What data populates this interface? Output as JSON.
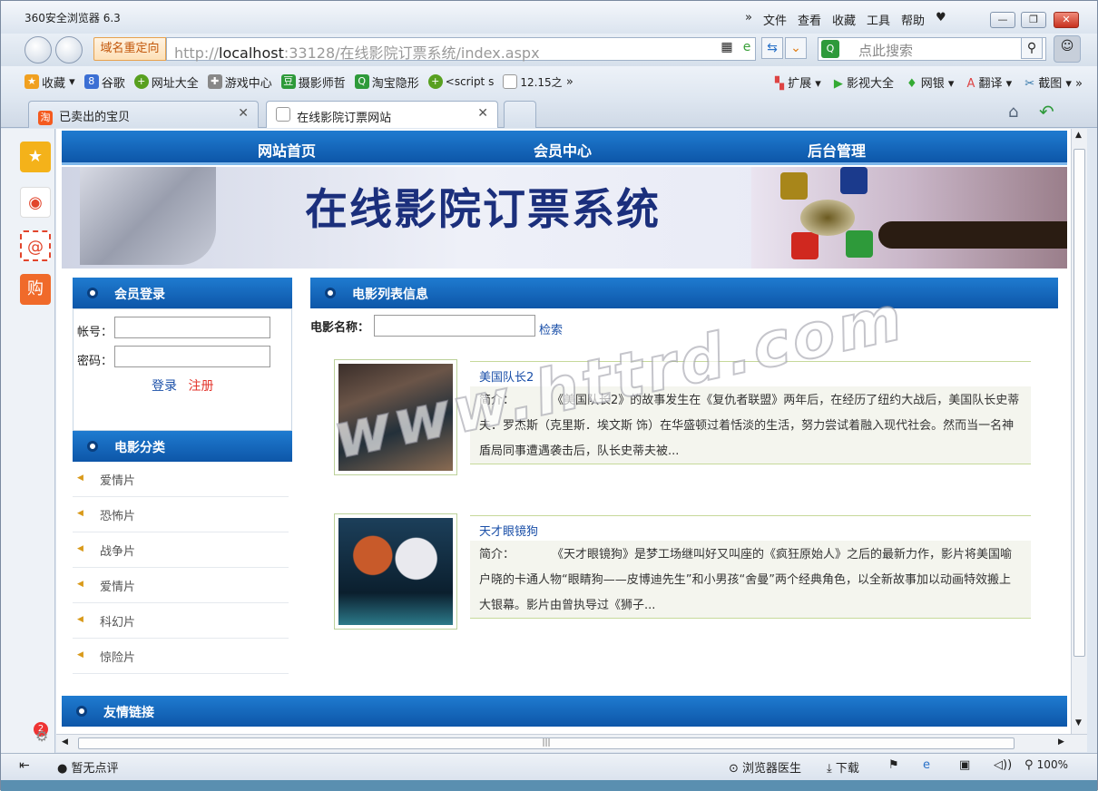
{
  "browser": {
    "app_title": "360安全浏览器 6.3",
    "menu": [
      "文件",
      "查看",
      "收藏",
      "工具",
      "帮助"
    ],
    "redirect_label": "域名重定向",
    "url_prefix": "http://",
    "url_host": "localhost",
    "url_rest": ":33128/在线影院订票系统/index.aspx",
    "search_placeholder": "点此搜索",
    "bookmarks": [
      {
        "label": "收藏",
        "icon": "star-icon",
        "color": "#f0a020"
      },
      {
        "label": "谷歌",
        "icon": "google-icon",
        "color": "#3b6fd4"
      },
      {
        "label": "网址大全",
        "icon": "plus-icon",
        "color": "#58a020"
      },
      {
        "label": "游戏中心",
        "icon": "gamepad-icon",
        "color": "#888888"
      },
      {
        "label": "摄影师哲",
        "icon": "douban-icon",
        "color": "#2e9a3a"
      },
      {
        "label": "淘宝隐形",
        "icon": "search-icon",
        "color": "#2e9a3a"
      },
      {
        "label": "<script s",
        "icon": "plus-icon",
        "color": "#58a020"
      },
      {
        "label": "12.15之",
        "icon": "page-icon",
        "color": "#999999"
      }
    ],
    "bookmark_right": [
      "扩展",
      "影视大全",
      "网银",
      "翻译",
      "截图"
    ],
    "tabs": [
      {
        "label": "已卖出的宝贝",
        "active": false
      },
      {
        "label": "在线影院订票网站",
        "active": true
      }
    ],
    "status_left": "暂无点评",
    "status_right": [
      "浏览器医生",
      "下载",
      "100%"
    ],
    "notification_badge": "2"
  },
  "site": {
    "nav": [
      "网站首页",
      "会员中心",
      "后台管理"
    ],
    "banner_title": "在线影院订票系统",
    "login": {
      "header": "会员登录",
      "account_label": "帐号：",
      "password_label": "密码：",
      "login_link": "登录",
      "register_link": "注册"
    },
    "categories": {
      "header": "电影分类",
      "items": [
        "爱情片",
        "恐怖片",
        "战争片",
        "爱情片",
        "科幻片",
        "惊险片"
      ]
    },
    "movie_list": {
      "header": "电影列表信息",
      "search_label": "电影名称：",
      "search_button": "检索",
      "movies": [
        {
          "title": "美国队长2",
          "intro_label": "简介：",
          "intro": "《美国队长2》的故事发生在《复仇者联盟》两年后，在经历了纽约大战后，美国队长史蒂夫．罗杰斯（克里斯．埃文斯 饰）在华盛顿过着恬淡的生活，努力尝试着融入现代社会。然而当一名神盾局同事遭遇袭击后，队长史蒂夫被..."
        },
        {
          "title": "天才眼镜狗",
          "intro_label": "简介：",
          "intro": "《天才眼镜狗》是梦工场继叫好又叫座的《疯狂原始人》之后的最新力作，影片将美国喻户晓的卡通人物“眼睛狗——皮博迪先生”和小男孩“舍曼”两个经典角色，以全新故事加以动画特效搬上大银幕。影片由曾执导过《狮子..."
        }
      ]
    },
    "footer_header": "友情链接",
    "watermark": "www.httrd.com"
  },
  "colors": {
    "nav_blue": "#0d56a8",
    "banner_title": "#1b2f7c",
    "link_blue": "#1a4fa8",
    "register_red": "#e3352d"
  }
}
